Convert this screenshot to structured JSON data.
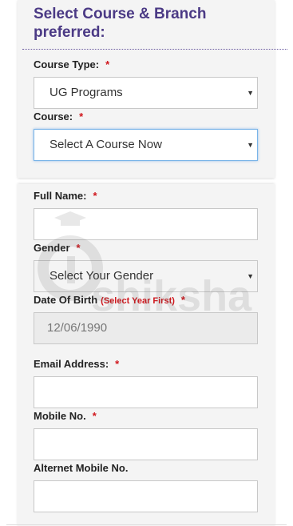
{
  "section": {
    "title_line1": "Select Course & Branch",
    "title_line2": "preferred:"
  },
  "course_type": {
    "label": "Course Type:",
    "required": "*",
    "value": "UG Programs"
  },
  "course": {
    "label": "Course:",
    "required": "*",
    "value": "Select A Course Now"
  },
  "full_name": {
    "label": "Full Name:",
    "required": "*",
    "value": ""
  },
  "gender": {
    "label": "Gender",
    "required": "*",
    "value": "Select Your Gender"
  },
  "dob": {
    "label": "Date Of Birth",
    "hint": "(Select Year First)",
    "required": "*",
    "value": "12/06/1990"
  },
  "email": {
    "label": "Email Address:",
    "required": "*",
    "value": ""
  },
  "mobile": {
    "label": "Mobile No.",
    "required": "*",
    "value": ""
  },
  "alt_mobile": {
    "label": "Alternet Mobile No.",
    "value": ""
  },
  "watermark": {
    "text": "shiksha"
  },
  "caret_glyph": "▼",
  "colors": {
    "title": "#4b3a85",
    "required": "#d0161c",
    "focus": "#7ab4e8"
  }
}
